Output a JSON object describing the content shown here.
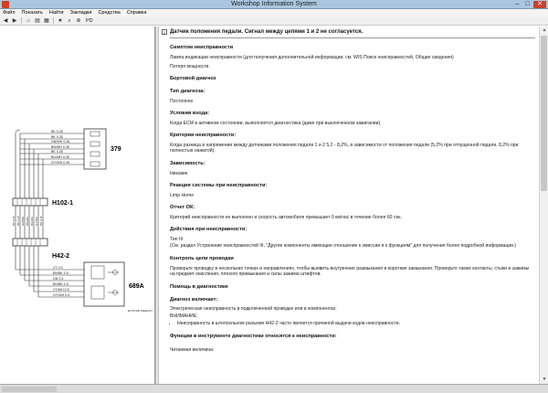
{
  "window": {
    "title": "Workshop Information System",
    "min": "–",
    "max": "□",
    "close": "✕"
  },
  "menu": [
    "Файл",
    "Показать",
    "Найти",
    "Закладки",
    "Средства",
    "Справка"
  ],
  "toolbar": {
    "icons": [
      "back-icon",
      "forward-icon",
      "home-icon",
      "folder-icon",
      "print-icon",
      "bookmark-icon",
      "search-icon",
      "zoom-icon"
    ],
    "text": "PD"
  },
  "schematic": {
    "connectors": [
      "379",
      "H102-1",
      "H42-2",
      "689A"
    ],
    "wires_top": [
      "BK 0.35",
      "BK 0.35",
      "GN/WH 0.35",
      "BN/WH 0.35",
      "BK 0.35",
      "BU/WH 0.35",
      "GY/WH 0.35"
    ],
    "wires_bottom": [
      "VT 0.5",
      "BN/BK 0.5",
      "GN 0.5",
      "BU/BK 0.5",
      "VT/WH 0.5",
      "GY/WH 0.5"
    ],
    "label_689a_sub": "ДТАТЧИК ПЕДАЛИ"
  },
  "doc": {
    "title": "Датчик положения педали. Сигнал между цепями 1 и 2 не согласуется.",
    "sections": [
      {
        "heading": "Симптом неисправности",
        "paras": [
          "Лампа индикации неисправности (для получения дополнительной информации, см. WIS Поиск неисправностей, Общие сведения)",
          "Потеря мощности."
        ]
      },
      {
        "heading": "Бортовой диагноз",
        "paras": []
      },
      {
        "heading": "Тип диагноза:",
        "paras": [
          "Постоянно"
        ]
      },
      {
        "heading": "Условия входа:",
        "paras": [
          "Когда ECM в активном состоянии, выполняется диагностика (даже при выключенном зажигании)."
        ]
      },
      {
        "heading": "Критерии неисправности:",
        "paras": [
          "Когда разница в напряжении между датчиками положения педали 1 и 2 5,2 - 8,2%, в зависимости от положения педали (5,2% при отпущенной педали, 8,2% при полностью нажатой)."
        ]
      },
      {
        "heading": "Зависимость:",
        "paras": [
          "Никакие"
        ]
      },
      {
        "heading": "Реакция системы при неисправности:",
        "paras": [
          "Limp Home"
        ]
      },
      {
        "heading": "Отчет ОК:",
        "paras": [
          "Критерий неисправности не выполнен и скорость автомобиля превышает 0 км/час в течение более 60 сек."
        ]
      },
      {
        "heading": "Действия при неисправности:",
        "paras": [
          "Тип III",
          "(См. раздел Устранение неисправностей III, \"Другие компоненты имеющие отношение к эмиссии и к функциям\" для получения более подробной информации.)"
        ]
      },
      {
        "heading": "Контроль цепи проводки",
        "paras": [
          "Проверьте проводку в нескольких точках и направлениях, чтобы выявить внутренние размыкания и короткие замыкания. Проверьте также контакты, стыки и зажимы на предмет окисления, плохого примыкания и силы зажима штифтов."
        ]
      },
      {
        "heading": "Помощь в диагностике",
        "paras": []
      },
      {
        "heading": "Диагноз включает:",
        "paras": [
          "Электрическая неисправность в подключенной проводке или в компонентах.",
          "ВНИМАНИЕ:"
        ]
      }
    ],
    "bullet": "Неисправность в штепсельном разъеме H42-2 часто является причиной выдачи кодов неисправности.",
    "final_heading": "Функции в инструменте диагностики относятся к неисправности:",
    "final_para": "Читаемая величина:"
  }
}
